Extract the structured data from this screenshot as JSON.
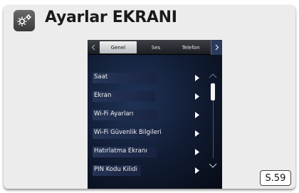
{
  "header": {
    "title": "Ayarlar EKRANI",
    "icon": "gears-icon"
  },
  "tabs": [
    {
      "label": "Genel",
      "selected": true
    },
    {
      "label": "Ses",
      "selected": false
    },
    {
      "label": "Telefon",
      "selected": false
    }
  ],
  "menu": {
    "items": [
      {
        "label": "Saat"
      },
      {
        "label": "Ekran"
      },
      {
        "label": "Wi-Fi Ayarları"
      },
      {
        "label": "Wi-Fi Güvenlik Bilgileri"
      },
      {
        "label": "Hatırlatma Ekranı"
      },
      {
        "label": "PIN Kodu Kilidi"
      }
    ]
  },
  "page_reference": "S.59",
  "colors": {
    "card_background": "#ececec",
    "screen_background": "#101a30",
    "selected_tab": "#d8dade",
    "accent_scroll": "#2b3a5e"
  }
}
